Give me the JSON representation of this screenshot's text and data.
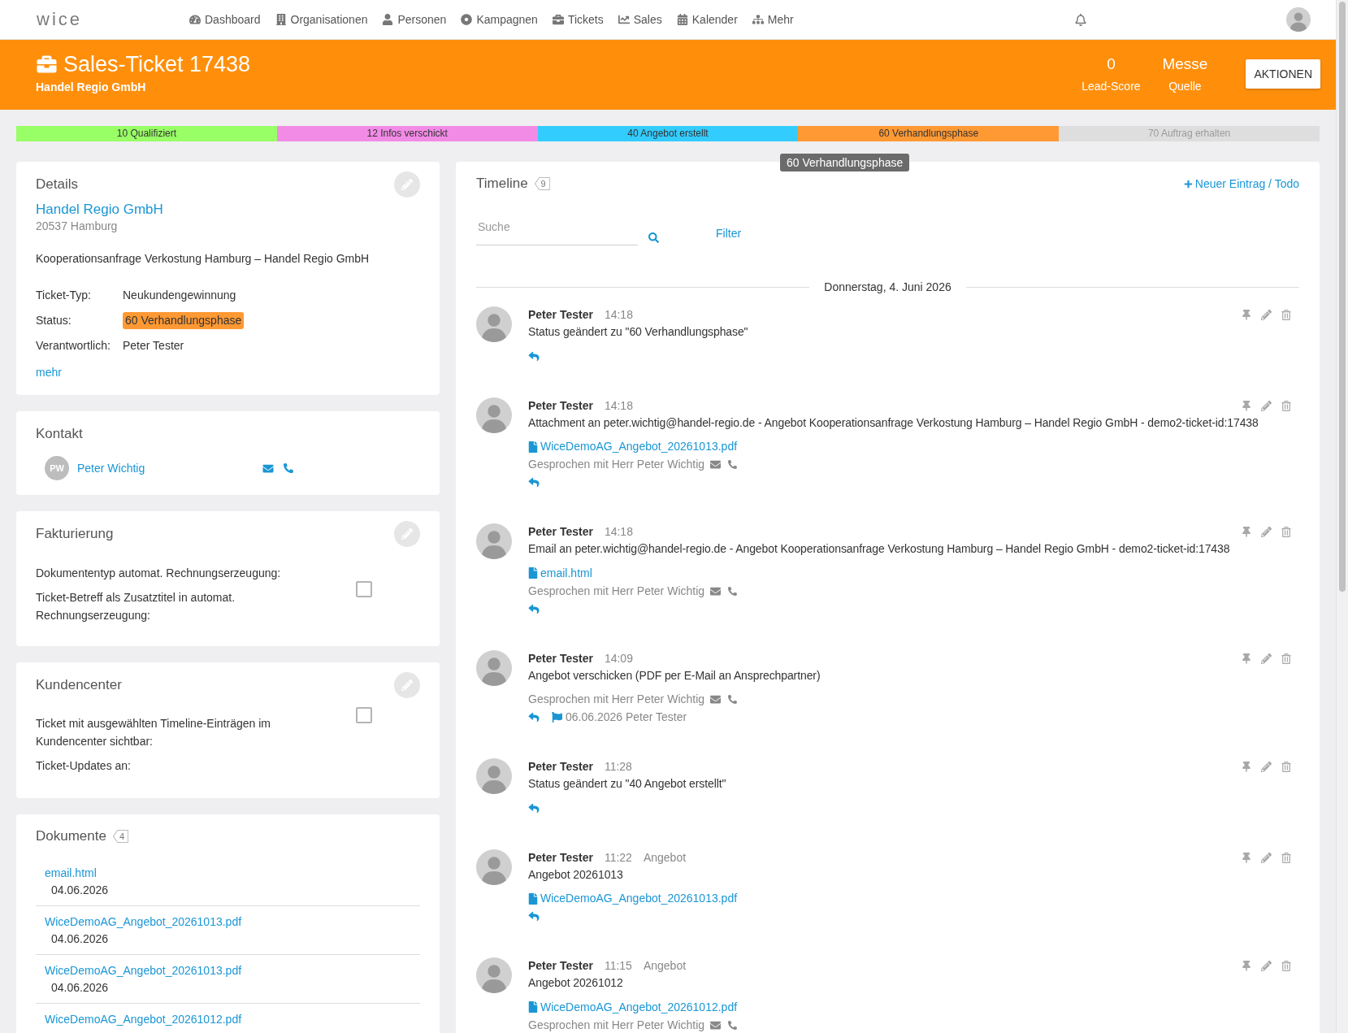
{
  "nav": {
    "logo": "wice",
    "items": [
      {
        "label": "Dashboard"
      },
      {
        "label": "Organisationen"
      },
      {
        "label": "Personen"
      },
      {
        "label": "Kampagnen"
      },
      {
        "label": "Tickets"
      },
      {
        "label": "Sales"
      },
      {
        "label": "Kalender"
      },
      {
        "label": "Mehr"
      }
    ]
  },
  "header": {
    "title": "Sales-Ticket 17438",
    "subtitle": "Handel Regio GmbH",
    "stats": [
      {
        "value": "0",
        "label": "Lead-Score"
      },
      {
        "value": "Messe",
        "label": "Quelle"
      }
    ],
    "action": "AKTIONEN"
  },
  "stages": [
    {
      "label": "10 Qualifiziert",
      "color": "#99ff66",
      "reached": true
    },
    {
      "label": "12 Infos verschickt",
      "color": "#f28be6",
      "reached": true
    },
    {
      "label": "40 Angebot erstellt",
      "color": "#33ccff",
      "reached": true
    },
    {
      "label": "60 Verhandlungsphase",
      "color": "#ff9933",
      "reached": true
    },
    {
      "label": "70 Auftrag erhalten",
      "reached": false
    }
  ],
  "stage_tooltip": "60 Verhandlungsphase",
  "details": {
    "title": "Details",
    "company": "Handel Regio GmbH",
    "address": "20537 Hamburg",
    "subject": "Kooperationsanfrage Verkostung Hamburg – Handel Regio GmbH",
    "fields": [
      {
        "label": "Ticket-Typ:",
        "value": "Neukundengewinnung",
        "kind": "text"
      },
      {
        "label": "Status:",
        "value": "60 Verhandlungsphase",
        "kind": "badge"
      },
      {
        "label": "Verantwortlich:",
        "value": "Peter Tester",
        "kind": "text"
      }
    ],
    "more": "mehr"
  },
  "contact": {
    "title": "Kontakt",
    "people": [
      {
        "initials": "PW",
        "name": "Peter Wichtig"
      }
    ]
  },
  "billing": {
    "title": "Fakturierung",
    "fields": [
      {
        "label": "Dokumententyp automat. Rechnungserzeugung:",
        "kind": "text"
      },
      {
        "label": "Ticket-Betreff als Zusatztitel in automat. Rechnungserzeugung:",
        "kind": "checkbox",
        "checked": false
      }
    ]
  },
  "customer_center": {
    "title": "Kundencenter",
    "fields": [
      {
        "label": "Ticket mit ausgewählten Timeline-Einträgen im Kundencenter sichtbar:",
        "kind": "checkbox",
        "checked": false
      },
      {
        "label": "Ticket-Updates an:",
        "kind": "text"
      }
    ]
  },
  "documents": {
    "title": "Dokumente",
    "count": "4",
    "items": [
      {
        "name": "email.html",
        "date": "04.06.2026"
      },
      {
        "name": "WiceDemoAG_Angebot_20261013.pdf",
        "date": "04.06.2026"
      },
      {
        "name": "WiceDemoAG_Angebot_20261013.pdf",
        "date": "04.06.2026"
      },
      {
        "name": "WiceDemoAG_Angebot_20261012.pdf"
      }
    ]
  },
  "timeline": {
    "title": "Timeline",
    "count": "9",
    "new_entry": "Neuer Eintrag / Todo",
    "search": {
      "placeholder": "Suche"
    },
    "filter": "Filter",
    "date_divider": "Donnerstag, 4. Juni 2026",
    "entries": [
      {
        "author": "Peter Tester",
        "time": "14:18",
        "text": "Status geändert zu \"60 Verhandlungsphase\"",
        "reply": true
      },
      {
        "author": "Peter Tester",
        "time": "14:18",
        "text": "Attachment an peter.wichtig@handel-regio.de - Angebot Kooperationsanfrage Verkostung Hamburg – Handel Regio GmbH - demo2-ticket-id:17438",
        "attachment": "WiceDemoAG_Angebot_20261013.pdf",
        "contact_note": "Gesprochen mit Herr Peter Wichtig",
        "reply": true
      },
      {
        "author": "Peter Tester",
        "time": "14:18",
        "text": "Email an peter.wichtig@handel-regio.de - Angebot Kooperationsanfrage Verkostung Hamburg – Handel Regio GmbH - demo2-ticket-id:17438",
        "attachment": "email.html",
        "contact_note": "Gesprochen mit Herr Peter Wichtig",
        "reply": true
      },
      {
        "author": "Peter Tester",
        "time": "14:09",
        "text": "Angebot verschicken (PDF per E-Mail an Ansprechpartner)",
        "contact_note": "Gesprochen mit Herr Peter Wichtig",
        "reply": true,
        "todo": "06.06.2026 Peter Tester"
      },
      {
        "author": "Peter Tester",
        "time": "11:28",
        "text": "Status geändert zu \"40 Angebot erstellt\"",
        "reply": true
      },
      {
        "author": "Peter Tester",
        "time": "11:22",
        "type": "Angebot",
        "text": "Angebot 20261013",
        "attachment": "WiceDemoAG_Angebot_20261013.pdf",
        "reply": true
      },
      {
        "author": "Peter Tester",
        "time": "11:15",
        "type": "Angebot",
        "text": "Angebot 20261012",
        "attachment": "WiceDemoAG_Angebot_20261012.pdf",
        "contact_note": "Gesprochen mit Herr Peter Wichtig",
        "reply": false
      }
    ]
  }
}
